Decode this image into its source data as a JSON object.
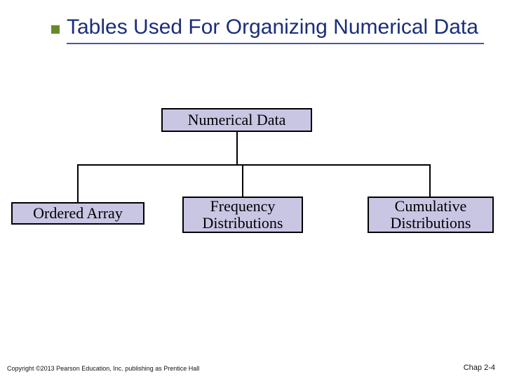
{
  "title": "Tables Used For Organizing Numerical Data",
  "diagram": {
    "root": "Numerical Data",
    "children": [
      "Ordered Array",
      "Frequency Distributions",
      "Cumulative Distributions"
    ]
  },
  "footer": {
    "copyright": "Copyright ©2013 Pearson Education, Inc. publishing as Prentice Hall",
    "page": "Chap 2-4"
  },
  "colors": {
    "title": "#1b2d7a",
    "box_fill": "#c9c6e4",
    "accent_square": "#668a2a"
  }
}
